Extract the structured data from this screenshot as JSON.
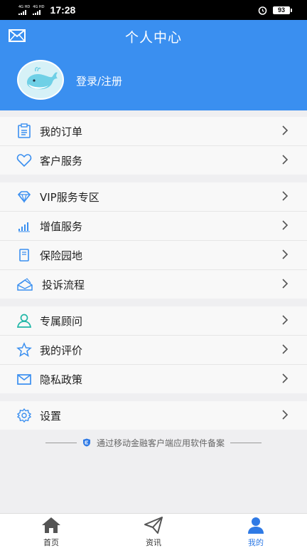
{
  "status_bar": {
    "network1": "4G HD",
    "network2": "4G HD",
    "time": "17:28",
    "battery": "93"
  },
  "header": {
    "title": "个人中心",
    "login_text": "登录/注册",
    "color": "#3a8ff0"
  },
  "menu": {
    "group1": [
      {
        "label": "我的订单",
        "icon": "order-list-icon"
      },
      {
        "label": "客户服务",
        "icon": "heart-icon"
      }
    ],
    "group2": [
      {
        "label": "VIP服务专区",
        "icon": "diamond-icon"
      },
      {
        "label": "增值服务",
        "icon": "bar-chart-icon"
      },
      {
        "label": "保险园地",
        "icon": "book-icon"
      },
      {
        "label": "投诉流程",
        "icon": "envelope-open-icon"
      }
    ],
    "group3": [
      {
        "label": "专属顾问",
        "icon": "person-icon"
      },
      {
        "label": "我的评价",
        "icon": "star-icon"
      },
      {
        "label": "隐私政策",
        "icon": "mail-icon"
      }
    ],
    "group4": [
      {
        "label": "设置",
        "icon": "gear-icon"
      }
    ]
  },
  "footer_note": "通过移动金融客户端应用软件备案",
  "tabbar": [
    {
      "label": "首页",
      "icon": "home-icon"
    },
    {
      "label": "资讯",
      "icon": "paper-plane-icon"
    },
    {
      "label": "我的",
      "icon": "user-icon",
      "active": true
    }
  ]
}
